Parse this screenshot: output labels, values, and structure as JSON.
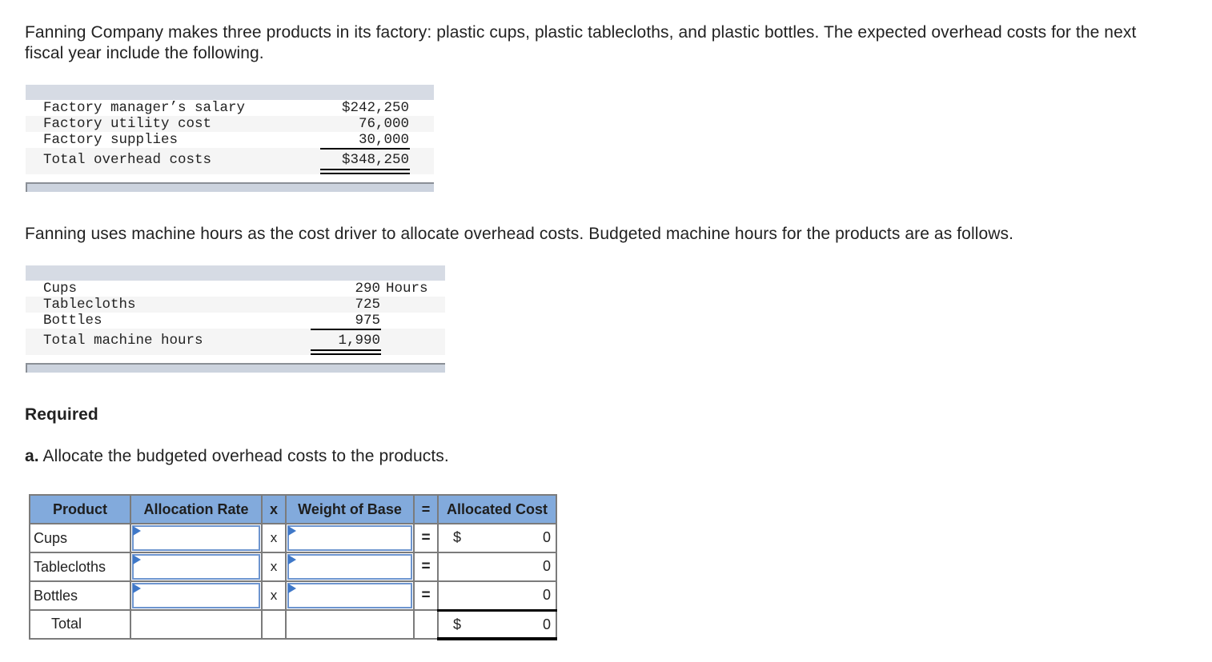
{
  "intro": "Fanning Company makes three products in its factory: plastic cups, plastic tablecloths, and plastic bottles. The expected overhead costs for the next fiscal year include the following.",
  "overhead": {
    "rows": [
      {
        "label": "Factory manager’s salary",
        "value": "$242,250"
      },
      {
        "label": "Factory utility cost",
        "value": "76,000"
      },
      {
        "label": "Factory supplies",
        "value": "30,000"
      }
    ],
    "total": {
      "label": "Total overhead costs",
      "value": "$348,250"
    }
  },
  "driver_text": "Fanning uses machine hours as the cost driver to allocate overhead costs. Budgeted machine hours for the products are as follows.",
  "hours": {
    "unit": "Hours",
    "rows": [
      {
        "label": "Cups",
        "value": "290"
      },
      {
        "label": "Tablecloths",
        "value": "725"
      },
      {
        "label": "Bottles",
        "value": "975"
      }
    ],
    "total": {
      "label": "Total machine hours",
      "value": "1,990"
    }
  },
  "required": {
    "heading": "Required",
    "part_a_prefix": "a.",
    "part_a_text": "Allocate the budgeted overhead costs to the products."
  },
  "allocation": {
    "headers": {
      "product": "Product",
      "rate": "Allocation Rate",
      "times": "x",
      "weight": "Weight of Base",
      "equals": "=",
      "cost": "Allocated Cost"
    },
    "rows": [
      {
        "product": "Cups",
        "times": "x",
        "equals": "=",
        "rate": "",
        "weight": "",
        "dollar": "$",
        "cost": "0"
      },
      {
        "product": "Tablecloths",
        "times": "x",
        "equals": "=",
        "rate": "",
        "weight": "",
        "dollar": "",
        "cost": "0"
      },
      {
        "product": "Bottles",
        "times": "x",
        "equals": "=",
        "rate": "",
        "weight": "",
        "dollar": "",
        "cost": "0"
      }
    ],
    "total": {
      "label": "Total",
      "dollar": "$",
      "cost": "0"
    }
  }
}
